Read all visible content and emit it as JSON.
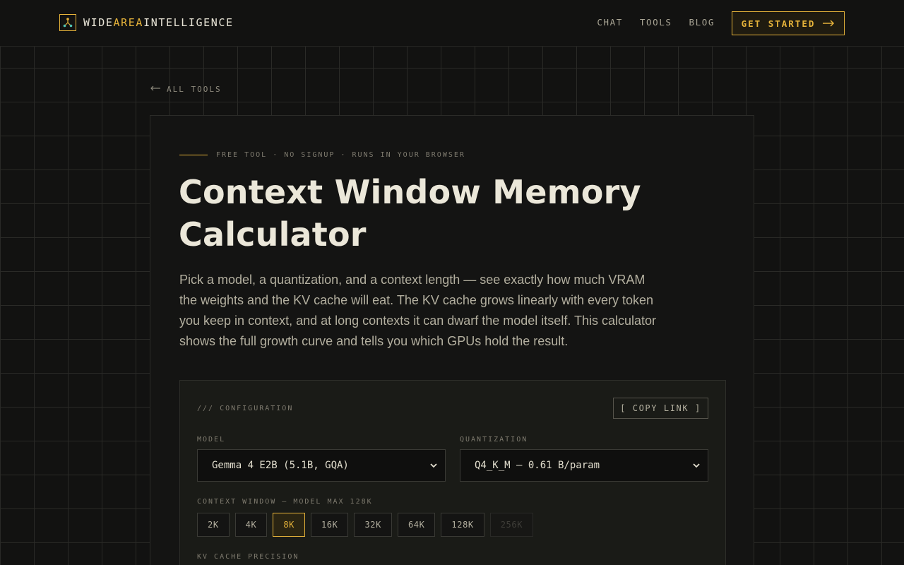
{
  "brand": {
    "part1": "WIDE",
    "part2": "AREA",
    "part3": "INTELLIGENCE"
  },
  "nav": {
    "links": [
      "CHAT",
      "TOOLS",
      "BLOG"
    ],
    "cta": "GET STARTED",
    "cta_icon": "arrow-right-icon"
  },
  "back_link": {
    "label": "ALL TOOLS",
    "icon": "arrow-left-icon"
  },
  "hero": {
    "eyebrow": "FREE TOOL · NO SIGNUP · RUNS IN YOUR BROWSER",
    "title": "Context Window Memory Calculator",
    "description": "Pick a model, a quantization, and a context length — see exactly how much VRAM the weights and the KV cache will eat. The KV cache grows linearly with every token you keep in context, and at long contexts it can dwarf the model itself. This calculator shows the full growth curve and tells you which GPUs hold the result."
  },
  "config": {
    "label": "/// CONFIGURATION",
    "copy_link": "[ COPY LINK ]",
    "model_label": "MODEL",
    "model_value": "Gemma 4 E2B (5.1B, GQA)",
    "quant_label": "QUANTIZATION",
    "quant_value": "Q4_K_M — 0.61 B/param",
    "context_label": "CONTEXT WINDOW — MODEL MAX 128K",
    "context_options": [
      {
        "label": "2K",
        "state": "normal"
      },
      {
        "label": "4K",
        "state": "normal"
      },
      {
        "label": "8K",
        "state": "active"
      },
      {
        "label": "16K",
        "state": "normal"
      },
      {
        "label": "32K",
        "state": "normal"
      },
      {
        "label": "64K",
        "state": "normal"
      },
      {
        "label": "128K",
        "state": "normal"
      },
      {
        "label": "256K",
        "state": "disabled"
      }
    ],
    "kv_label": "KV CACHE PRECISION"
  },
  "colors": {
    "accent": "#e6b33a",
    "background": "#121211",
    "panel": "#1a1b17"
  }
}
